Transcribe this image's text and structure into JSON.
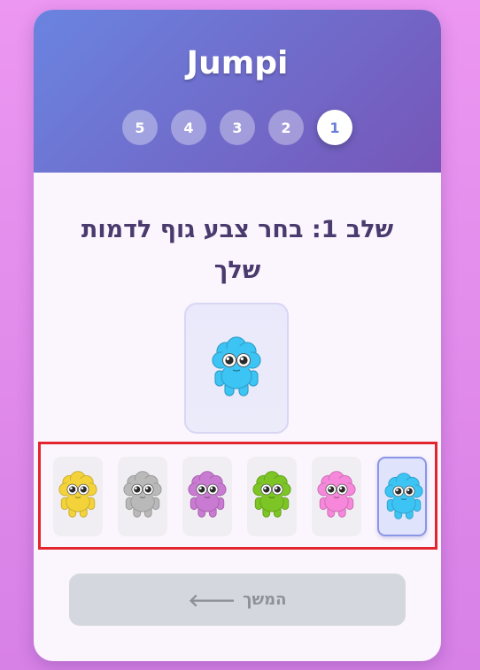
{
  "app": {
    "title": "Jumpi"
  },
  "steps": [
    "5",
    "4",
    "3",
    "2",
    "1"
  ],
  "current_step": "1",
  "main": {
    "heading": "שלב 1: בחר צבע גוף לדמות שלך"
  },
  "preview": {
    "character_color": "#3cc4f5"
  },
  "colors": [
    {
      "name": "yellow",
      "hex": "#f4d33a"
    },
    {
      "name": "gray",
      "hex": "#b9b9b9"
    },
    {
      "name": "purple",
      "hex": "#c97ad2"
    },
    {
      "name": "green",
      "hex": "#7cc524"
    },
    {
      "name": "pink",
      "hex": "#f687da"
    },
    {
      "name": "blue",
      "hex": "#3cc4f5",
      "selected": true
    }
  ],
  "footer": {
    "continue_label": "המשך",
    "continue_icon": "arrow-left-icon"
  }
}
